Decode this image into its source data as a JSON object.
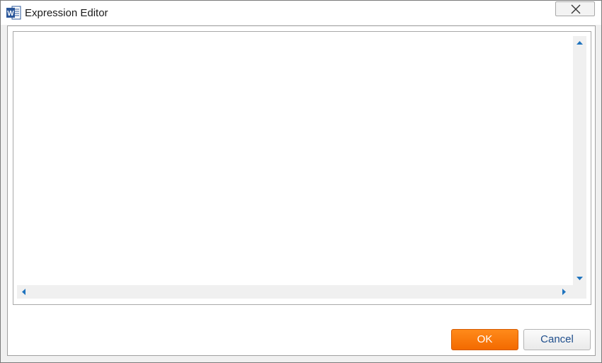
{
  "window": {
    "title": "Expression Editor",
    "app_icon": "word-icon",
    "close_icon": "close-icon"
  },
  "editor": {
    "value": "",
    "scroll_icons": {
      "up": "scroll-up-arrow-icon",
      "down": "scroll-down-arrow-icon",
      "left": "scroll-left-arrow-icon",
      "right": "scroll-right-arrow-icon"
    }
  },
  "buttons": {
    "ok_label": "OK",
    "cancel_label": "Cancel"
  },
  "colors": {
    "accent": "#f47a0c",
    "link_blue": "#1f4e8c",
    "scroll_arrow": "#1e73be"
  }
}
